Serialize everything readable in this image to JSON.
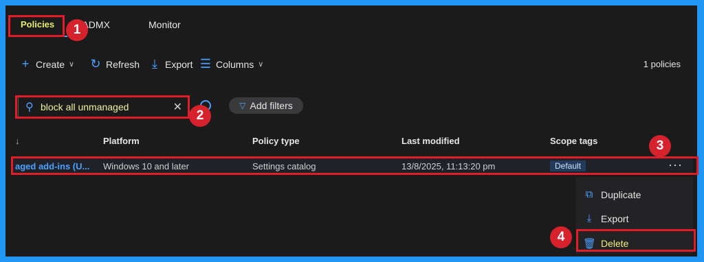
{
  "tabs": {
    "policies": "Policies",
    "import": "Import ADMX",
    "import_visible": "ort ADMX",
    "monitor": "Monitor"
  },
  "toolbar": {
    "create": "Create",
    "refresh": "Refresh",
    "export": "Export",
    "columns": "Columns",
    "count": "1 policies"
  },
  "search": {
    "value": "block all unmanaged",
    "add_filters": "Add filters"
  },
  "table": {
    "headers": {
      "sort": "↓",
      "platform": "Platform",
      "policy_type": "Policy type",
      "last_modified": "Last modified",
      "scope_tags": "Scope tags"
    },
    "row": {
      "name": "aged add-ins (U...",
      "platform": "Windows 10 and later",
      "policy_type": "Settings catalog",
      "last_modified": "13/8/2025, 11:13:20 pm",
      "scope_tag": "Default",
      "more": "···"
    }
  },
  "menu": {
    "duplicate": "Duplicate",
    "export": "Export",
    "delete": "Delete"
  },
  "annotations": {
    "b1": "1",
    "b2": "2",
    "b3": "3",
    "b4": "4"
  },
  "colors": {
    "accent": "#4ea0ff",
    "highlight": "#e11d2a",
    "background": "#1b1b1c",
    "frame": "#2196f3"
  }
}
